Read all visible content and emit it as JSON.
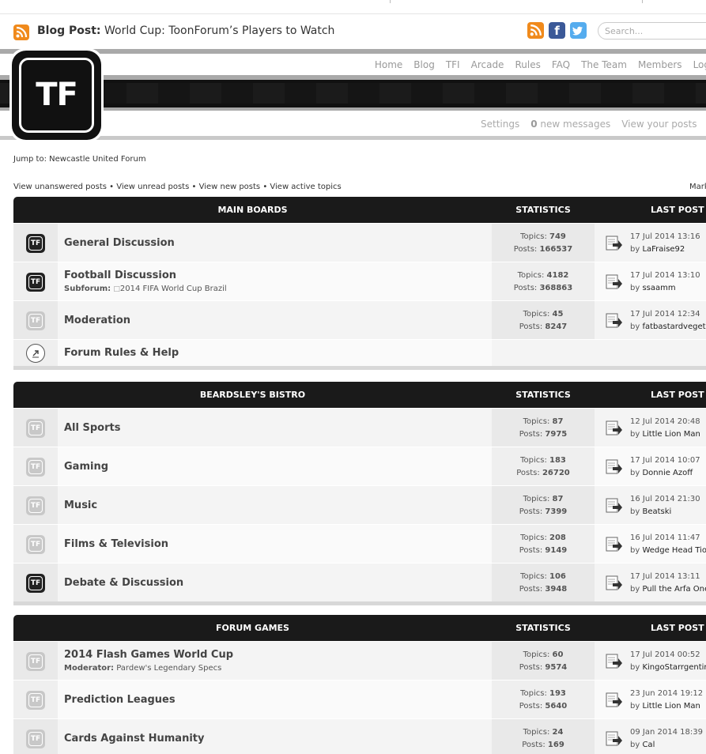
{
  "blog": {
    "prefix": "Blog Post:",
    "title": "World Cup: ToonForum’s Players to Watch",
    "search_placeholder": "Search..."
  },
  "logo_text": "TF",
  "nav": [
    "Home",
    "Blog",
    "TFI",
    "Arcade",
    "Rules",
    "FAQ",
    "The Team",
    "Members",
    "Log"
  ],
  "subnav": {
    "settings": "Settings",
    "msg_count": "0",
    "msg_label": "new messages",
    "view_posts": "View your posts",
    "more": "M"
  },
  "jump": "Jump to: Newcastle United Forum",
  "links": "View unanswered posts • View unread posts • View new posts • View active topics",
  "mark": "Mark",
  "headers": {
    "statistics": "STATISTICS",
    "last_post": "LAST POST"
  },
  "labels": {
    "topics": "Topics:",
    "posts": "Posts:",
    "by": "by",
    "subforum": "Subforum:",
    "moderator": "Moderator:"
  },
  "sections": [
    {
      "title": "MAIN BOARDS",
      "forums": [
        {
          "name": "General Discussion",
          "icon": "on",
          "topics": "749",
          "posts": "166537",
          "date": "17 Jul 2014 13:16",
          "by": "LaFraise92"
        },
        {
          "name": "Football Discussion",
          "icon": "on",
          "sub_label": "Subforum:",
          "sub": "2014 FIFA World Cup Brazil",
          "topics": "4182",
          "posts": "368863",
          "date": "17 Jul 2014 13:10",
          "by": "ssaamm"
        },
        {
          "name": "Moderation",
          "icon": "off",
          "topics": "45",
          "posts": "8247",
          "date": "17 Jul 2014 12:34",
          "by": "fatbastardvegeta"
        },
        {
          "name": "Forum Rules & Help",
          "icon": "link"
        }
      ]
    },
    {
      "title": "BEARDSLEY'S BISTRO",
      "forums": [
        {
          "name": "All Sports",
          "icon": "off",
          "topics": "87",
          "posts": "7975",
          "date": "12 Jul 2014 20:48",
          "by": "Little Lion Man"
        },
        {
          "name": "Gaming",
          "icon": "off",
          "topics": "183",
          "posts": "26720",
          "date": "17 Jul 2014 10:07",
          "by": "Donnie Azoff"
        },
        {
          "name": "Music",
          "icon": "off",
          "topics": "87",
          "posts": "7399",
          "date": "16 Jul 2014 21:30",
          "by": "Beatski"
        },
        {
          "name": "Films & Television",
          "icon": "off",
          "topics": "208",
          "posts": "9149",
          "date": "16 Jul 2014 11:47",
          "by": "Wedge Head Tiot"
        },
        {
          "name": "Debate & Discussion",
          "icon": "on",
          "topics": "106",
          "posts": "3948",
          "date": "17 Jul 2014 13:11",
          "by": "Pull the Arfa One"
        }
      ]
    },
    {
      "title": "FORUM GAMES",
      "forums": [
        {
          "name": "2014 Flash Games World Cup",
          "icon": "off",
          "sub_label": "Moderator:",
          "sub": "Pardew's Legendary Specs",
          "topics": "60",
          "posts": "9574",
          "date": "17 Jul 2014 00:52",
          "by": "KingoStarrgentina"
        },
        {
          "name": "Prediction Leagues",
          "icon": "off",
          "topics": "193",
          "posts": "5640",
          "date": "23 Jun 2014 19:12",
          "by": "Little Lion Man"
        },
        {
          "name": "Cards Against Humanity",
          "icon": "off",
          "topics": "24",
          "posts": "169",
          "date": "09 Jan 2014 18:39",
          "by": "Cal"
        }
      ]
    }
  ],
  "colors": {
    "header_black": "#1a1a1a",
    "rss_orange": "#f08a1c",
    "facebook": "#3b5998",
    "twitter": "#55acee"
  },
  "icons": [
    "rss-icon",
    "facebook-icon",
    "twitter-icon",
    "forum-read-icon",
    "forum-unread-icon",
    "forum-link-icon",
    "last-post-arrow-icon"
  ]
}
